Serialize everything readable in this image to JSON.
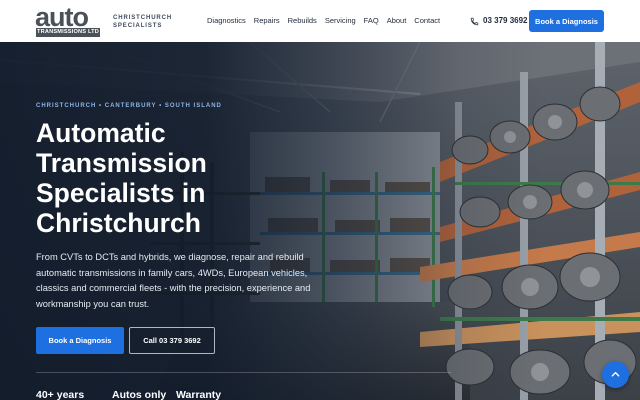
{
  "header": {
    "logo": {
      "word": "auto",
      "sub": "TRANSMISSIONS LTD"
    },
    "tagline": "CHRISTCHURCH SPECIALISTS",
    "nav": [
      "Diagnostics",
      "Repairs",
      "Rebuilds",
      "Servicing",
      "FAQ",
      "About",
      "Contact"
    ],
    "phone": "03 379 3692",
    "cta": "Book a Diagnosis"
  },
  "hero": {
    "eyebrow": "CHRISTCHURCH • CANTERBURY • SOUTH ISLAND",
    "title": "Automatic Transmission Specialists in Christchurch",
    "description": "From CVTs to DCTs and hybrids, we diagnose, repair and rebuild automatic transmissions in family cars, 4WDs, European vehicles, classics and commercial fleets - with the precision, experience and workmanship you can trust.",
    "primary_button": "Book a Diagnosis",
    "secondary_button": "Call 03 379 3692",
    "stats": [
      "40+ years",
      "Autos only",
      "Warranty"
    ]
  },
  "icons": {
    "phone": "phone-icon",
    "scroll_top": "chevron-up-icon"
  },
  "colors": {
    "accent": "#1e6fe0",
    "header_bg": "#ffffff",
    "hero_overlay": "#101a2a",
    "eyebrow": "#8fb3e6"
  }
}
